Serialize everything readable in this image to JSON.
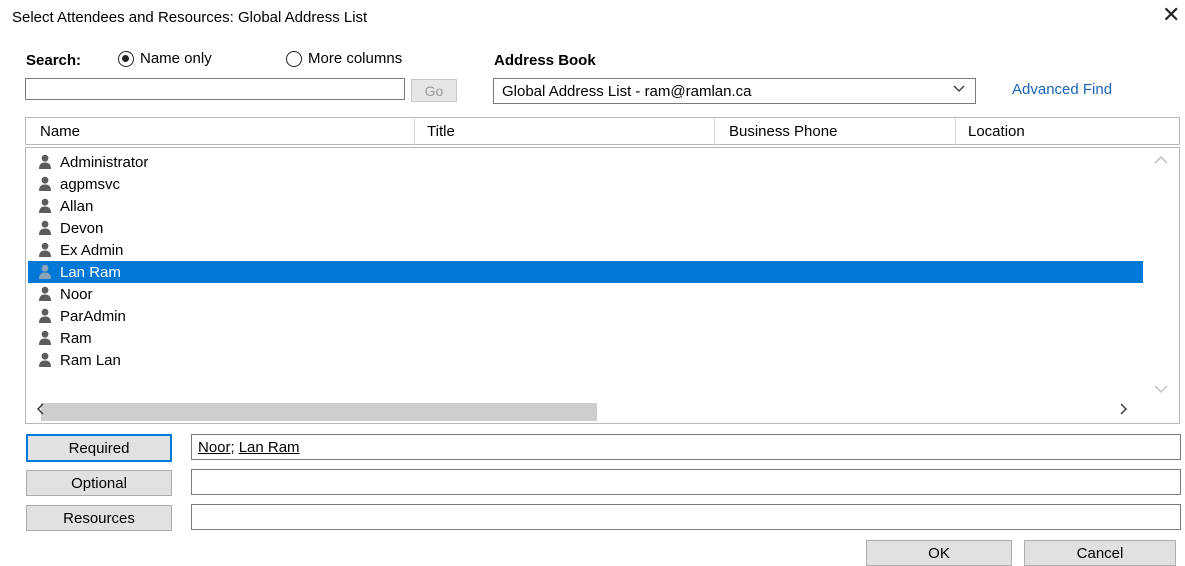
{
  "window": {
    "title": "Select Attendees and Resources: Global Address List",
    "close_glyph": "✕"
  },
  "search": {
    "label": "Search:",
    "name_only_label": "Name only",
    "more_columns_label": "More columns",
    "selected_option": "Name only",
    "value": "",
    "go_label": "Go"
  },
  "address_book": {
    "label": "Address Book",
    "selected": "Global Address List - ram@ramlan.ca",
    "advanced_find_label": "Advanced Find"
  },
  "columns": [
    "Name",
    "Title",
    "Business Phone",
    "Location"
  ],
  "entries": [
    {
      "name": "Administrator",
      "selected": false
    },
    {
      "name": "agpmsvc",
      "selected": false
    },
    {
      "name": "Allan",
      "selected": false
    },
    {
      "name": "Devon",
      "selected": false
    },
    {
      "name": "Ex Admin",
      "selected": false
    },
    {
      "name": "Lan Ram",
      "selected": true
    },
    {
      "name": "Noor",
      "selected": false
    },
    {
      "name": "ParAdmin",
      "selected": false
    },
    {
      "name": "Ram",
      "selected": false
    },
    {
      "name": "Ram Lan",
      "selected": false
    }
  ],
  "attendees": {
    "required_label": "Required",
    "required_values": [
      "Noor;",
      "Lan Ram"
    ],
    "optional_label": "Optional",
    "optional_value": "",
    "resources_label": "Resources",
    "resources_value": ""
  },
  "footer": {
    "ok_label": "OK",
    "cancel_label": "Cancel"
  },
  "colors": {
    "selection": "#0078d7",
    "link": "#1a63b5"
  }
}
